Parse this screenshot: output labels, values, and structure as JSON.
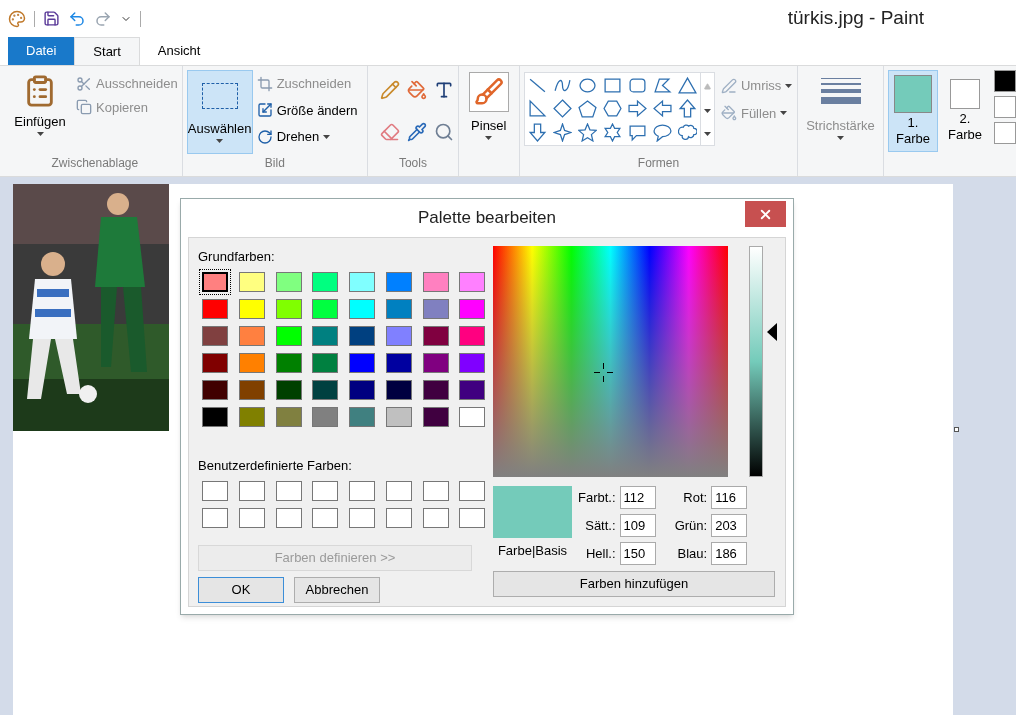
{
  "window": {
    "title": "türkis.jpg - Paint"
  },
  "tabs": [
    {
      "label": "Datei",
      "kind": "file",
      "selected": false
    },
    {
      "label": "Start",
      "kind": "tab",
      "selected": true
    },
    {
      "label": "Ansicht",
      "kind": "tab",
      "selected": false
    }
  ],
  "ribbon": {
    "clipboard": {
      "label": "Zwischenablage",
      "paste": "Einfügen",
      "items": [
        {
          "label": "Ausschneiden",
          "kind": "cut",
          "disabled": true
        },
        {
          "label": "Kopieren",
          "kind": "copy",
          "disabled": true
        }
      ]
    },
    "image": {
      "label": "Bild",
      "select": {
        "label": "Auswählen",
        "selected": true
      },
      "items": [
        {
          "label": "Zuschneiden",
          "kind": "crop",
          "disabled": true
        },
        {
          "label": "Größe ändern",
          "kind": "resize",
          "disabled": false
        },
        {
          "label": "Drehen",
          "kind": "rotate",
          "disabled": false
        }
      ]
    },
    "tools": {
      "label": "Tools"
    },
    "brushes": {
      "label": "Pinsel"
    },
    "shapes": {
      "label": "Formen",
      "outline": {
        "label": "Umriss",
        "disabled": true
      },
      "fill": {
        "label": "Füllen",
        "disabled": true
      }
    },
    "size": {
      "label": "Strichstärke",
      "disabled": true
    },
    "colors": [
      {
        "number": "1.",
        "label": "Farbe",
        "color": "#74cbba",
        "selected": true
      },
      {
        "number": "2.",
        "label": "Farbe",
        "color": "#ffffff",
        "selected": false
      }
    ],
    "palette_edge": [
      {
        "color": "#000000"
      },
      {
        "color": "#ffffff"
      },
      {
        "color": "#ffffff"
      }
    ]
  },
  "dialog": {
    "title": "Palette bearbeiten",
    "basic_label": "Grundfarben:",
    "basic_colors": [
      {
        "color": "#ff8080",
        "selected": true
      },
      {
        "color": "#ffff80",
        "selected": false
      },
      {
        "color": "#80ff80",
        "selected": false
      },
      {
        "color": "#00ff80",
        "selected": false
      },
      {
        "color": "#80ffff",
        "selected": false
      },
      {
        "color": "#0080ff",
        "selected": false
      },
      {
        "color": "#ff80c0",
        "selected": false
      },
      {
        "color": "#ff80ff",
        "selected": false
      },
      {
        "color": "#ff0000",
        "selected": false
      },
      {
        "color": "#ffff00",
        "selected": false
      },
      {
        "color": "#80ff00",
        "selected": false
      },
      {
        "color": "#00ff40",
        "selected": false
      },
      {
        "color": "#00ffff",
        "selected": false
      },
      {
        "color": "#0080c0",
        "selected": false
      },
      {
        "color": "#8080c0",
        "selected": false
      },
      {
        "color": "#ff00ff",
        "selected": false
      },
      {
        "color": "#804040",
        "selected": false
      },
      {
        "color": "#ff8040",
        "selected": false
      },
      {
        "color": "#00ff00",
        "selected": false
      },
      {
        "color": "#008080",
        "selected": false
      },
      {
        "color": "#004080",
        "selected": false
      },
      {
        "color": "#8080ff",
        "selected": false
      },
      {
        "color": "#800040",
        "selected": false
      },
      {
        "color": "#ff0080",
        "selected": false
      },
      {
        "color": "#800000",
        "selected": false
      },
      {
        "color": "#ff8000",
        "selected": false
      },
      {
        "color": "#008000",
        "selected": false
      },
      {
        "color": "#008040",
        "selected": false
      },
      {
        "color": "#0000ff",
        "selected": false
      },
      {
        "color": "#0000a0",
        "selected": false
      },
      {
        "color": "#800080",
        "selected": false
      },
      {
        "color": "#8000ff",
        "selected": false
      },
      {
        "color": "#400000",
        "selected": false
      },
      {
        "color": "#804000",
        "selected": false
      },
      {
        "color": "#004000",
        "selected": false
      },
      {
        "color": "#004040",
        "selected": false
      },
      {
        "color": "#000080",
        "selected": false
      },
      {
        "color": "#000040",
        "selected": false
      },
      {
        "color": "#400040",
        "selected": false
      },
      {
        "color": "#400080",
        "selected": false
      },
      {
        "color": "#000000",
        "selected": false
      },
      {
        "color": "#808000",
        "selected": false
      },
      {
        "color": "#808040",
        "selected": false
      },
      {
        "color": "#808080",
        "selected": false
      },
      {
        "color": "#408080",
        "selected": false
      },
      {
        "color": "#c0c0c0",
        "selected": false
      },
      {
        "color": "#400040",
        "selected": false
      },
      {
        "color": "#ffffff",
        "selected": false
      }
    ],
    "custom_label": "Benutzerdefinierte Farben:",
    "custom_colors": [
      {
        "color": "#ffffff"
      },
      {
        "color": "#ffffff"
      },
      {
        "color": "#ffffff"
      },
      {
        "color": "#ffffff"
      },
      {
        "color": "#ffffff"
      },
      {
        "color": "#ffffff"
      },
      {
        "color": "#ffffff"
      },
      {
        "color": "#ffffff"
      },
      {
        "color": "#ffffff"
      },
      {
        "color": "#ffffff"
      },
      {
        "color": "#ffffff"
      },
      {
        "color": "#ffffff"
      },
      {
        "color": "#ffffff"
      },
      {
        "color": "#ffffff"
      },
      {
        "color": "#ffffff"
      },
      {
        "color": "#ffffff"
      }
    ],
    "define_button": {
      "label": "Farben definieren >>",
      "disabled": true
    },
    "ok": "OK",
    "cancel": "Abbrechen",
    "luminance": {
      "level": 0.63
    },
    "preview": {
      "color": "#74cbba",
      "label": "Farbe|Basis"
    },
    "fields": [
      {
        "label": "Farbt.:",
        "value": "112"
      },
      {
        "label": "Sätt.:",
        "value": "109"
      },
      {
        "label": "Hell.:",
        "value": "150"
      },
      {
        "label": "Rot:",
        "value": "116"
      },
      {
        "label": "Grün:",
        "value": "203"
      },
      {
        "label": "Blau:",
        "value": "186"
      }
    ],
    "add_button": "Farben hinzufügen"
  }
}
